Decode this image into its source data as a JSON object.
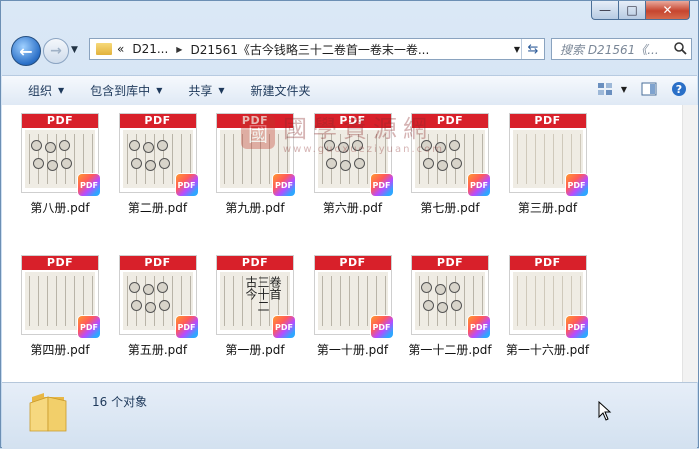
{
  "window": {
    "caption_buttons": {
      "minimize": "—",
      "maximize": "□",
      "close": "✕"
    }
  },
  "nav": {
    "back_symbol": "←",
    "forward_symbol": "→",
    "address": {
      "overflow": "«",
      "segments": [
        "D21...",
        "D21561《古今钱略三十二卷首一卷末一卷..."
      ]
    },
    "search_placeholder": "搜索 D21561《..."
  },
  "toolbar": {
    "organize": "组织",
    "include_in_library": "包含到库中",
    "share": "共享",
    "new_folder": "新建文件夹"
  },
  "files": [
    {
      "name": "第八册.pdf",
      "thumb": "coins"
    },
    {
      "name": "第二册.pdf",
      "thumb": "coins"
    },
    {
      "name": "第九册.pdf",
      "thumb": "lines"
    },
    {
      "name": "第六册.pdf",
      "thumb": "coins"
    },
    {
      "name": "第七册.pdf",
      "thumb": "coins"
    },
    {
      "name": "第三册.pdf",
      "thumb": "text"
    },
    {
      "name": "第四册.pdf",
      "thumb": "lines"
    },
    {
      "name": "第五册.pdf",
      "thumb": "coins"
    },
    {
      "name": "第一册.pdf",
      "thumb": "title",
      "title_chars": [
        "古今",
        "三十二",
        "卷首"
      ]
    },
    {
      "name": "第一十册.pdf",
      "thumb": "lines"
    },
    {
      "name": "第一十二册.pdf",
      "thumb": "coins"
    },
    {
      "name": "第一十六册.pdf",
      "thumb": "text"
    }
  ],
  "thumb_band_label": "PDF",
  "badge_label": "PDF",
  "watermark": {
    "cn": "國學資源網",
    "en": "www.guoxueziyuan.com",
    "seal": "國"
  },
  "status": {
    "count_text": "16 个对象"
  },
  "colors": {
    "pdf_band": "#d8202a",
    "window_frame": "#c3d8ee",
    "close_button": "#c6452f"
  }
}
